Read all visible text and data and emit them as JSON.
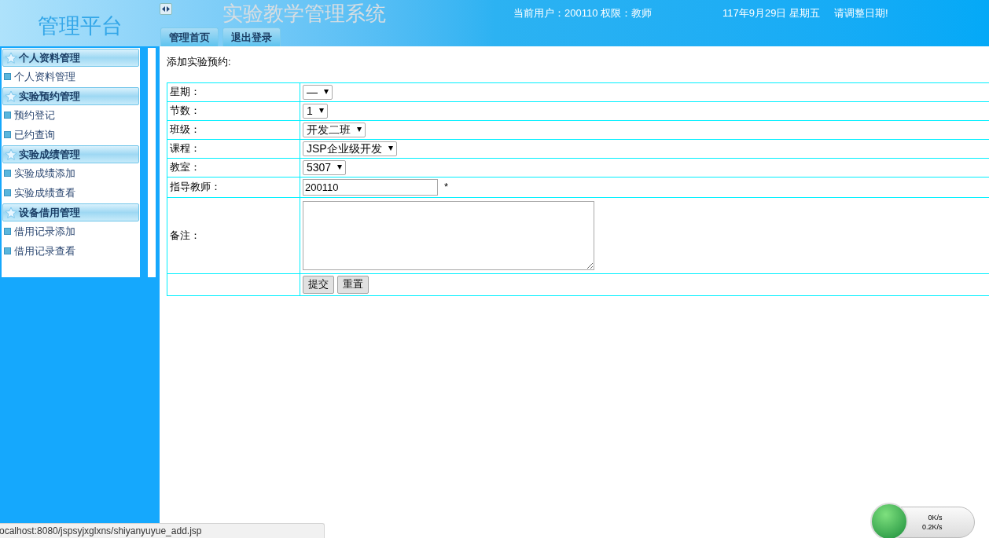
{
  "header": {
    "platform_title": "管理平台",
    "system_title": "实验教学管理系统",
    "user_info": "当前用户：200110 权限：教师",
    "date": "117年9月29日 星期五",
    "date_notice": "请调整日期!",
    "nav_tabs": [
      {
        "label": "管理首页"
      },
      {
        "label": "退出登录"
      }
    ]
  },
  "sidebar": {
    "groups": [
      {
        "title": "个人资料管理",
        "items": [
          "个人资料管理"
        ]
      },
      {
        "title": "实验预约管理",
        "items": [
          "预约登记",
          "已约查询"
        ]
      },
      {
        "title": "实验成绩管理",
        "items": [
          "实验成绩添加",
          "实验成绩查看"
        ]
      },
      {
        "title": "设备借用管理",
        "items": [
          "借用记录添加",
          "借用记录查看"
        ]
      }
    ]
  },
  "form": {
    "title": "添加实验预约:",
    "rows": [
      {
        "kind": "select",
        "label": "星期：",
        "value": "—"
      },
      {
        "kind": "select",
        "label": "节数：",
        "value": "1"
      },
      {
        "kind": "select",
        "label": "班级：",
        "value": "开发二班"
      },
      {
        "kind": "select",
        "label": "课程：",
        "value": "JSP企业级开发"
      },
      {
        "kind": "select",
        "label": "教室：",
        "value": "5307"
      },
      {
        "kind": "input",
        "label": "指导教师：",
        "value": "200110",
        "required_mark": "*"
      },
      {
        "kind": "textarea",
        "label": "备注："
      },
      {
        "kind": "buttons",
        "buttons": [
          "提交",
          "重置"
        ]
      }
    ]
  },
  "status_bar": {
    "url": "ocalhost:8080/jspsyjxglxns/shiyanyuyue_add.jsp"
  },
  "speed_widget": {
    "upload": "0K/s",
    "download": "0.2K/s"
  }
}
